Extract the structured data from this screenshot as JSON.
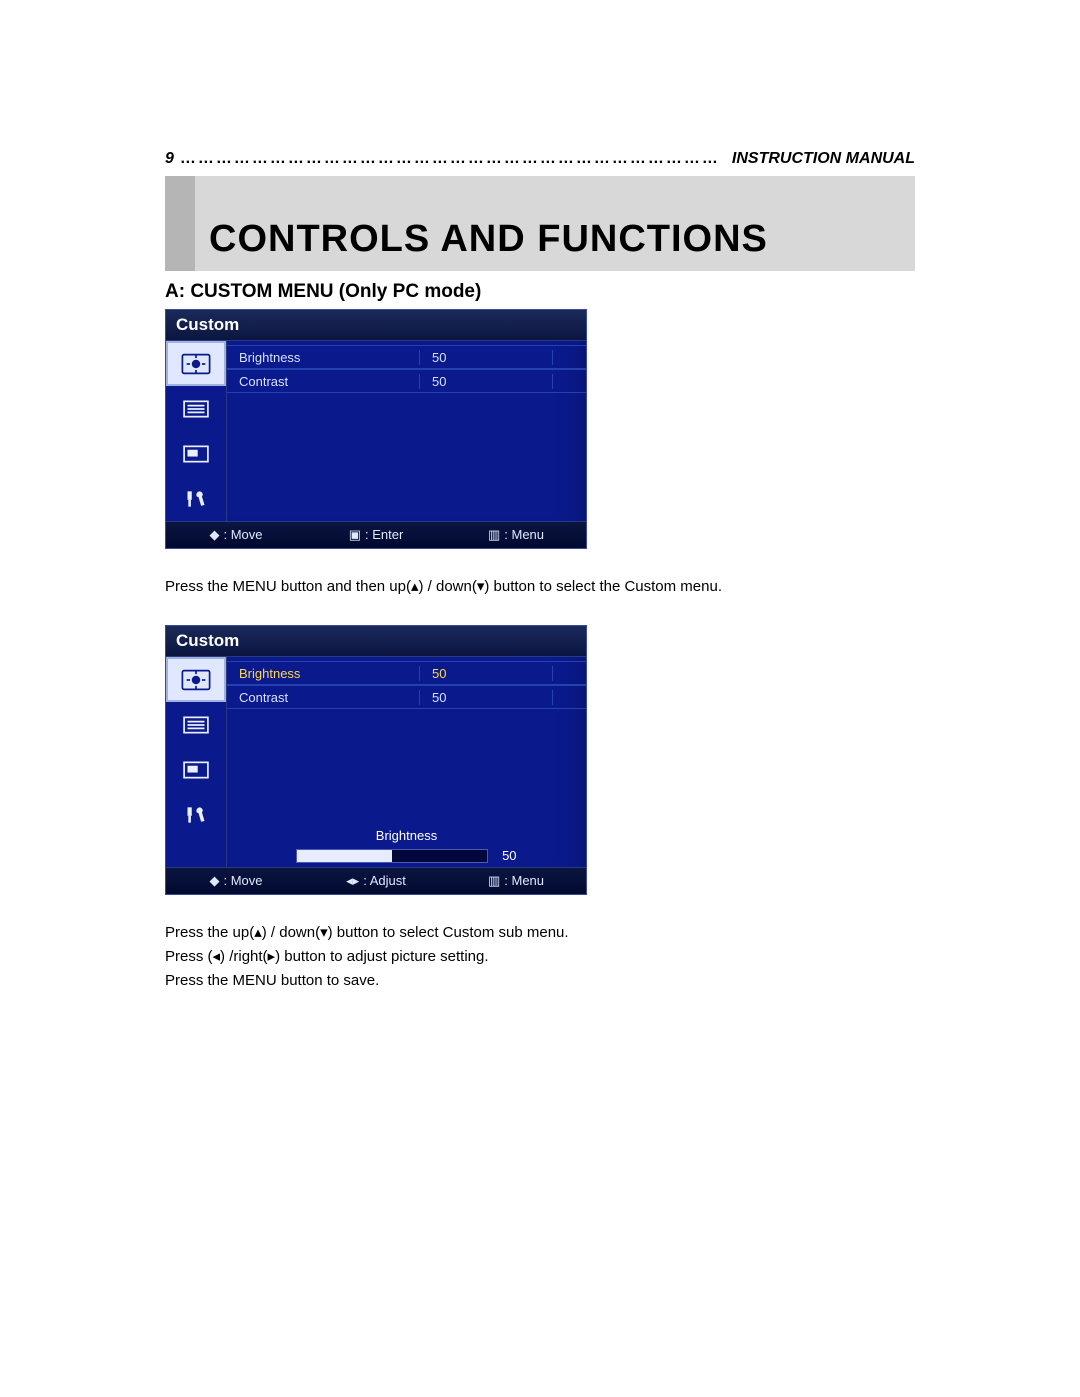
{
  "header": {
    "page_number": "9",
    "dots": "………………………………………………………………………………",
    "manual_label": "Instruction Manual"
  },
  "banner": {
    "title": "CONTROLS AND FUNCTIONS"
  },
  "section_heading": "A: CUSTOM MENU (Only PC mode)",
  "osd1": {
    "title": "Custom",
    "rows": [
      {
        "label": "Brightness",
        "value": "50"
      },
      {
        "label": "Contrast",
        "value": "50"
      }
    ],
    "footer": {
      "move": ": Move",
      "enter": ": Enter",
      "menu": ": Menu"
    }
  },
  "para1": "Press the MENU button and then up(▴) / down(▾) button to select the Custom menu.",
  "osd2": {
    "title": "Custom",
    "rows": [
      {
        "label": "Brightness",
        "value": "50",
        "selected": true
      },
      {
        "label": "Contrast",
        "value": "50"
      }
    ],
    "slider": {
      "label": "Brightness",
      "value": "50",
      "percent": 50
    },
    "footer": {
      "move": ": Move",
      "adjust": ": Adjust",
      "menu": ": Menu"
    }
  },
  "para2a": "Press the up(▴) / down(▾) button to select Custom sub menu.",
  "para2b": "Press (◂) /right(▸) button to adjust picture setting.",
  "para2c": "Press the MENU button to save."
}
